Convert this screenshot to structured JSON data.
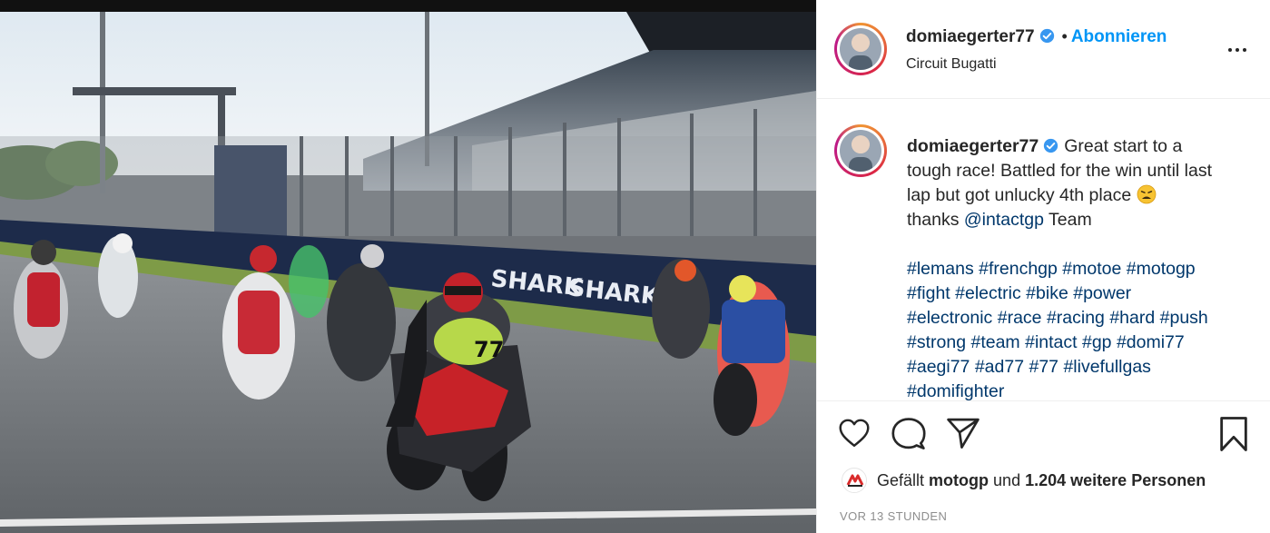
{
  "post": {
    "username": "domiaegerter77",
    "follow_label": "Abonnieren",
    "location": "Circuit Bugatti",
    "separator": "•",
    "caption": {
      "line1": "Great start to a",
      "line2": "tough race! Battled for the win until last",
      "line3": "lap but got unlucky 4th place",
      "line4_prefix": "thanks ",
      "mention": "@intactgp",
      "line4_suffix": " Team",
      "hashtags": [
        [
          "#lemans",
          "#frenchgp",
          "#motoe",
          "#motogp"
        ],
        [
          "#fight",
          "#electric",
          "#bike",
          "#power"
        ],
        [
          "#electronic",
          "#race",
          "#racing",
          "#hard",
          "#push"
        ],
        [
          "#strong",
          "#team",
          "#intact",
          "#gp",
          "#domi77"
        ],
        [
          "#aegi77",
          "#ad77",
          "#77",
          "#livefullgas"
        ],
        [
          "#domifighter"
        ]
      ]
    },
    "likes": {
      "prefix": "Gefällt",
      "liker": "motogp",
      "middle": "und",
      "count_text": "1.204 weitere Personen"
    },
    "timestamp": "VOR 13 STUNDEN",
    "icons": {
      "verified": "verified-badge-icon",
      "more": "more-options-icon",
      "like": "heart-icon",
      "comment": "comment-icon",
      "share": "paper-plane-icon",
      "save": "bookmark-icon",
      "emoji": "weary-face-emoji"
    },
    "photo": {
      "bike_number": "77",
      "sponsor_board": "SHARK"
    }
  },
  "colors": {
    "follow": "#0095f6",
    "link": "#00376b",
    "text": "#262626",
    "muted": "#8e8e8e",
    "verified": "#3897f0"
  }
}
